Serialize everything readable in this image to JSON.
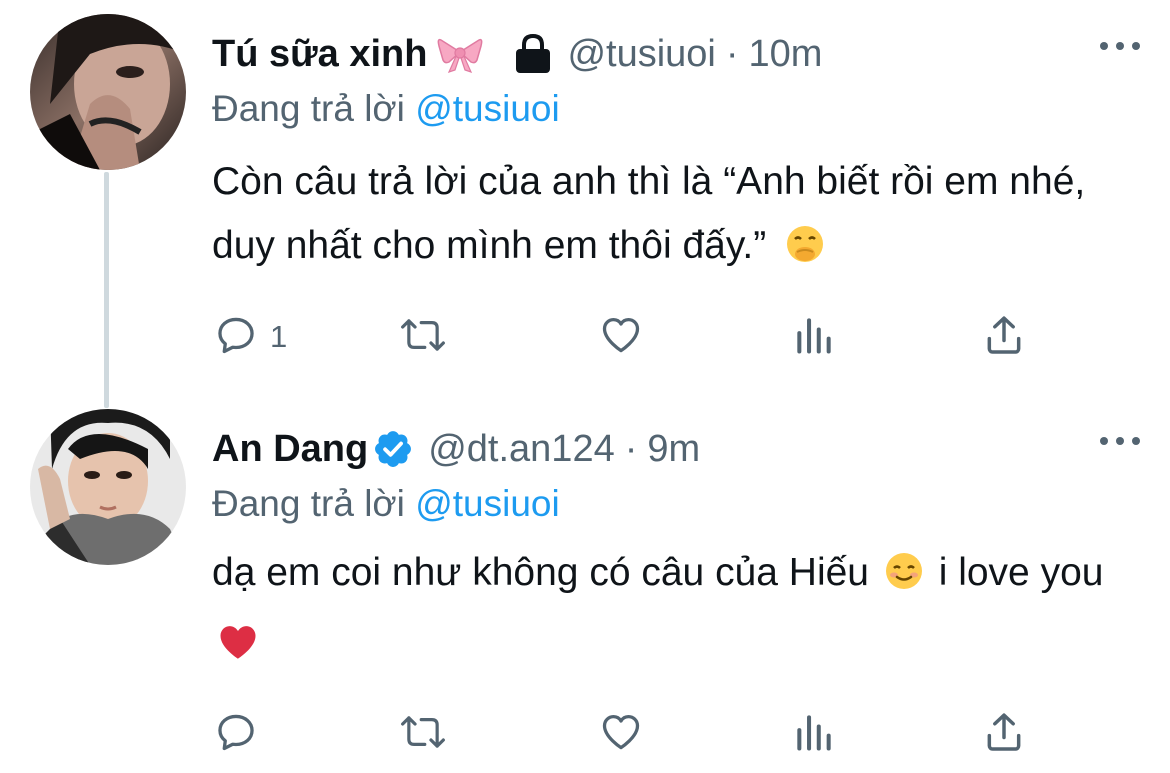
{
  "tweets": [
    {
      "author_name": "Tú sữa xinh",
      "author_emoji": "ribbon-emoji",
      "locked": true,
      "handle": "@tusiuoi",
      "separator": "·",
      "time": "10m",
      "reply_prefix": "Đang trả lời",
      "reply_handle": "@tusiuoi",
      "text": "Còn câu trả lời của anh thì là “Anh biết rồi em nhé, duy nhất cho mình em thôi đấy.”",
      "text_emoji": "face-with-hand-over-mouth-emoji",
      "reply_count": "1",
      "avatar": "avatar-photo"
    },
    {
      "author_name": "An Dang",
      "verified": true,
      "handle": "@dt.an124",
      "separator": "·",
      "time": "9m",
      "reply_prefix": "Đang trả lời",
      "reply_handle": "@tusiuoi",
      "text_part1": "dạ em coi như không có câu của Hiếu",
      "text_part2": "i love you",
      "text_emojis": [
        "smiling-face-emoji",
        "red-heart-emoji"
      ],
      "reply_count": "",
      "avatar": "avatar-photo"
    }
  ],
  "colors": {
    "secondary_text": "#536471",
    "link": "#1d9bf0",
    "thread_line": "#cfd9de",
    "verified": "#1d9bf0"
  },
  "icons": [
    "reply-icon",
    "retweet-icon",
    "like-icon",
    "views-icon",
    "share-icon",
    "more-icon",
    "lock-icon",
    "verified-badge-icon"
  ]
}
